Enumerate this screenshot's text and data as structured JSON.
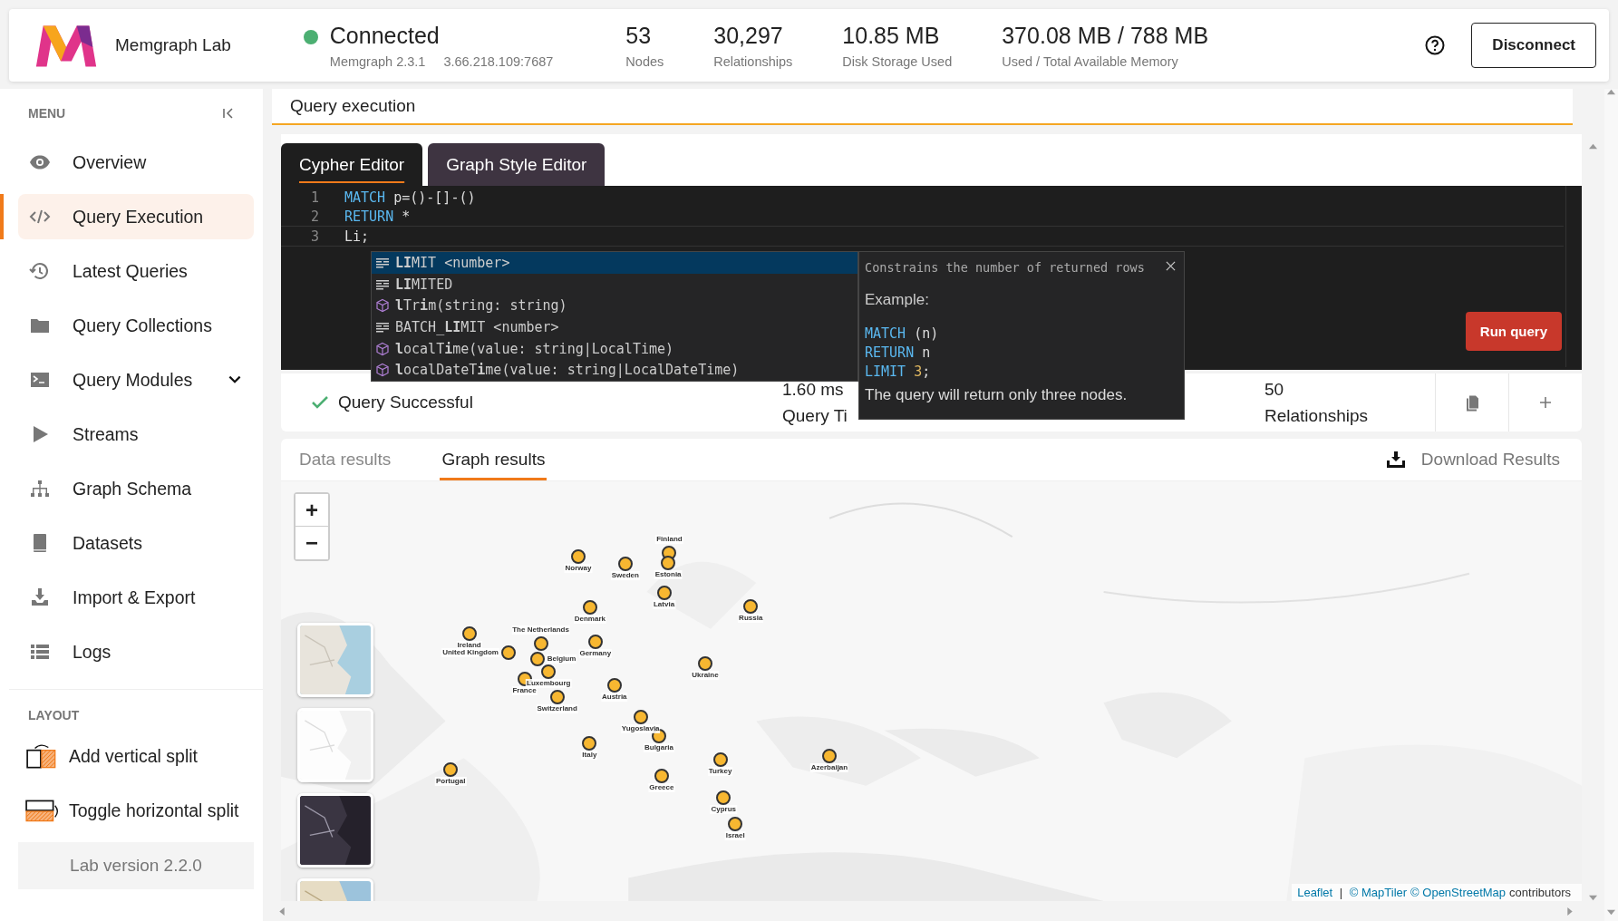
{
  "app": {
    "name": "Memgraph Lab"
  },
  "connection": {
    "status": "Connected",
    "connected": true,
    "version": "Memgraph 2.3.1",
    "address": "3.66.218.109:7687"
  },
  "stats": [
    {
      "value": "53",
      "label": "Nodes"
    },
    {
      "value": "30,297",
      "label": "Relationships"
    },
    {
      "value": "10.85 MB",
      "label": "Disk Storage Used"
    },
    {
      "value": "370.08 MB / 788 MB",
      "label": "Used / Total Available Memory"
    }
  ],
  "disconnect_button": "Disconnect",
  "sidebar": {
    "menu_title": "MENU",
    "items": [
      {
        "label": "Overview",
        "selected": false
      },
      {
        "label": "Query Execution",
        "selected": true
      },
      {
        "label": "Latest Queries",
        "selected": false
      },
      {
        "label": "Query Collections",
        "selected": false
      },
      {
        "label": "Query Modules",
        "selected": false,
        "expandable": true
      },
      {
        "label": "Streams",
        "selected": false
      },
      {
        "label": "Graph Schema",
        "selected": false
      },
      {
        "label": "Datasets",
        "selected": false
      },
      {
        "label": "Import & Export",
        "selected": false
      },
      {
        "label": "Logs",
        "selected": false
      }
    ],
    "layout_title": "LAYOUT",
    "layout_items": [
      {
        "label": "Add vertical split"
      },
      {
        "label": "Toggle horizontal split"
      }
    ],
    "version": "Lab version 2.2.0"
  },
  "page_title": "Query execution",
  "editor": {
    "tabs": [
      {
        "label": "Cypher Editor",
        "selected": true
      },
      {
        "label": "Graph Style Editor",
        "selected": false
      }
    ],
    "lines": [
      {
        "number": "1",
        "tokens": [
          {
            "text": "MATCH",
            "kind": "keyword"
          },
          {
            "text": " p=()-[]-()",
            "kind": "plain"
          }
        ]
      },
      {
        "number": "2",
        "tokens": [
          {
            "text": "RETURN",
            "kind": "keyword"
          },
          {
            "text": " *",
            "kind": "plain"
          }
        ]
      },
      {
        "number": "3",
        "tokens": [
          {
            "text": "Li;",
            "kind": "plain"
          }
        ]
      }
    ],
    "run_button": "Run query"
  },
  "autocomplete": {
    "suggestions": [
      {
        "text": "**LI**MIT <number>",
        "kind": "keyword",
        "selected": true
      },
      {
        "text": "**LI**MITED",
        "kind": "keyword",
        "selected": false
      },
      {
        "text": "**l**Tr**i**m(string: string)",
        "kind": "function",
        "selected": false
      },
      {
        "text": "BATCH_**LI**MIT <number>",
        "kind": "keyword",
        "selected": false
      },
      {
        "text": "**l**ocalT**i**me(value: string|LocalTime)",
        "kind": "function",
        "selected": false
      },
      {
        "text": "**l**ocalDateT**i**me(value: string|LocalDateTime)",
        "kind": "function",
        "selected": false
      }
    ],
    "detail": {
      "description": "Constrains the number of returned rows",
      "example_label": "Example:",
      "example": [
        {
          "tokens": [
            {
              "text": "MATCH",
              "kind": "keyword"
            },
            {
              "text": " (n)",
              "kind": "plain"
            }
          ]
        },
        {
          "tokens": [
            {
              "text": "RETURN",
              "kind": "keyword"
            },
            {
              "text": " n",
              "kind": "plain"
            }
          ]
        },
        {
          "tokens": [
            {
              "text": "LIMIT",
              "kind": "keyword"
            },
            {
              "text": " 3",
              "kind": "number"
            },
            {
              "text": ";",
              "kind": "plain"
            }
          ]
        }
      ],
      "note": "The query will return only three nodes."
    }
  },
  "summary": {
    "status": "Query Successful",
    "time_value": "1.60 ms",
    "time_label": "Query Ti",
    "relationships_value": "50",
    "relationships_label": "Relationships"
  },
  "results": {
    "tabs": [
      {
        "label": "Data results",
        "selected": false
      },
      {
        "label": "Graph results",
        "selected": true
      }
    ],
    "download": "Download Results",
    "map": {
      "nodes": [
        {
          "label": "Norway"
        },
        {
          "label": "Sweden"
        },
        {
          "label": "Finland"
        },
        {
          "label": "Estonia"
        },
        {
          "label": "Latvia"
        },
        {
          "label": "Russia"
        },
        {
          "label": "Denmark"
        },
        {
          "label": "Ireland"
        },
        {
          "label": "United Kingdom"
        },
        {
          "label": "The Netherlands"
        },
        {
          "label": "Belgium"
        },
        {
          "label": "Luxembourg"
        },
        {
          "label": "France"
        },
        {
          "label": "Germany"
        },
        {
          "label": "Switzerland"
        },
        {
          "label": "Austria"
        },
        {
          "label": "Ukraine"
        },
        {
          "label": "Yugoslavia"
        },
        {
          "label": "Bulgaria"
        },
        {
          "label": "Italy"
        },
        {
          "label": "Portugal"
        },
        {
          "label": "Greece"
        },
        {
          "label": "Turkey"
        },
        {
          "label": "Azerbaijan"
        },
        {
          "label": "Cyprus"
        },
        {
          "label": "Israel"
        }
      ],
      "layers": [
        {
          "kind": "street"
        },
        {
          "kind": "light"
        },
        {
          "kind": "dark"
        },
        {
          "kind": "satellite"
        }
      ],
      "zoom_in": "+",
      "zoom_out": "−",
      "attribution": [
        {
          "text": "Leaflet",
          "kind": "link"
        },
        {
          "text": " | ",
          "kind": "text"
        },
        {
          "text": "© MapTiler",
          "kind": "link"
        },
        {
          "text": "© OpenStreetMap",
          "kind": "link"
        },
        {
          "text": "contributors",
          "kind": "text"
        }
      ]
    }
  }
}
